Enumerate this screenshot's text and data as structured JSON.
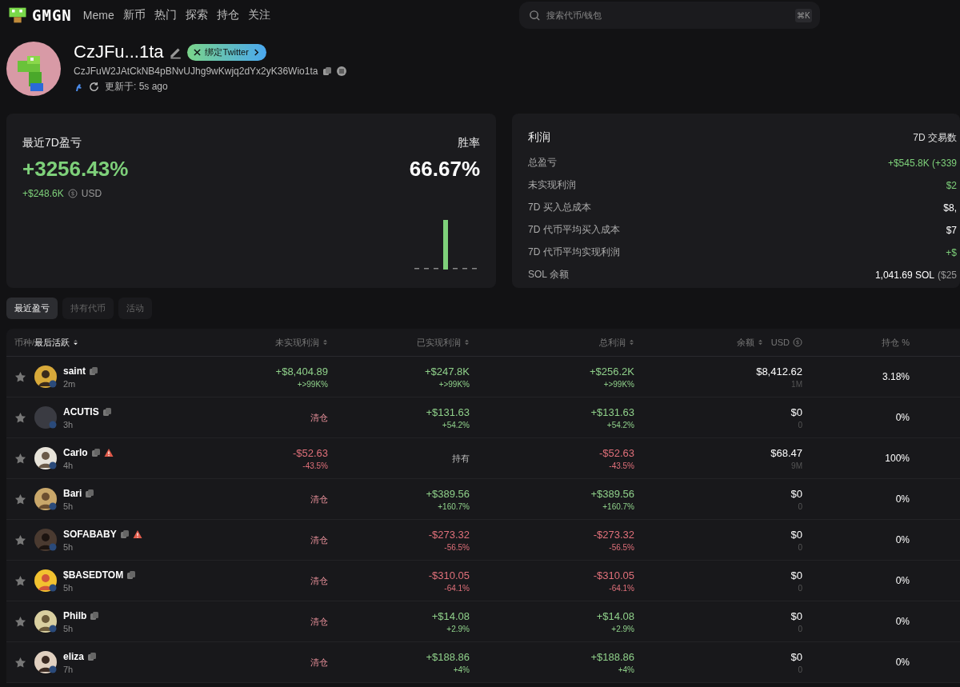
{
  "nav": {
    "brand": "GMGN",
    "items": [
      "Meme",
      "新币",
      "热门",
      "探索",
      "持仓",
      "关注"
    ],
    "search": {
      "placeholder": "搜索代币/钱包",
      "shortcut": "⌘K"
    }
  },
  "profile": {
    "name": "CzJFu...1ta",
    "twitter_button": "绑定Twitter",
    "address": "CzJFuW2JAtCkNB4pBNvUJhg9wKwjq2dYx2yK36Wio1ta",
    "updated": "更新于: 5s ago"
  },
  "pnl_card": {
    "title": "最近7D盈亏",
    "percent": "+3256.43%",
    "amount": "+$248.6K",
    "currency": "USD",
    "winrate_label": "胜率",
    "winrate": "66.67%"
  },
  "profit_card": {
    "title": "利润",
    "right_title": "7D 交易数",
    "rows": [
      {
        "label": "总盈亏",
        "value": "+$545.8K (+339",
        "kind": "gain"
      },
      {
        "label": "未实现利润",
        "value": "$2",
        "kind": "gain"
      },
      {
        "label": "7D 买入总成本",
        "value": "$8,",
        "kind": "plain"
      },
      {
        "label": "7D 代币平均买入成本",
        "value": "$7",
        "kind": "plain"
      },
      {
        "label": "7D 代币平均实现利润",
        "value": "+$",
        "kind": "gain"
      },
      {
        "label": "SOL 余额",
        "value": "1,041.69 SOL",
        "extra": "($25",
        "kind": "plain"
      }
    ]
  },
  "tabs": [
    {
      "label": "最近盈亏",
      "selected": true
    },
    {
      "label": "持有代币",
      "selected": false
    },
    {
      "label": "活动",
      "selected": false
    }
  ],
  "table": {
    "columns": {
      "token": "币种/",
      "token_sorted": "最后活跃",
      "unrealized": "未实现利润",
      "realized": "已实现利润",
      "total": "总利润",
      "balance": "余额",
      "balance_unit": "USD",
      "holding": "持仓 %"
    },
    "rows": [
      {
        "name": "saint",
        "time": "2m",
        "warning": false,
        "unrealized": {
          "text": "+$8,404.89",
          "sub": "+>99K%",
          "kind": "gain"
        },
        "realized": {
          "text": "+$247.8K",
          "sub": "+>99K%",
          "kind": "gain"
        },
        "total": {
          "text": "+$256.2K",
          "sub": "+>99K%",
          "kind": "gain"
        },
        "balance": "$8,412.62",
        "amount": "1M",
        "holding": "3.18%"
      },
      {
        "name": "ACUTIS",
        "time": "3h",
        "warning": false,
        "unrealized": {
          "text": "清仓",
          "kind": "sold"
        },
        "realized": {
          "text": "+$131.63",
          "sub": "+54.2%",
          "kind": "gain"
        },
        "total": {
          "text": "+$131.63",
          "sub": "+54.2%",
          "kind": "gain"
        },
        "balance": "$0",
        "amount": "0",
        "holding": "0%"
      },
      {
        "name": "Carlo",
        "time": "4h",
        "warning": true,
        "unrealized": {
          "text": "-$52.63",
          "sub": "-43.5%",
          "kind": "loss"
        },
        "realized": {
          "text": "持有",
          "kind": "held"
        },
        "total": {
          "text": "-$52.63",
          "sub": "-43.5%",
          "kind": "loss"
        },
        "balance": "$68.47",
        "amount": "9M",
        "holding": "100%"
      },
      {
        "name": "Bari",
        "time": "5h",
        "warning": false,
        "unrealized": {
          "text": "清仓",
          "kind": "sold"
        },
        "realized": {
          "text": "+$389.56",
          "sub": "+160.7%",
          "kind": "gain"
        },
        "total": {
          "text": "+$389.56",
          "sub": "+160.7%",
          "kind": "gain"
        },
        "balance": "$0",
        "amount": "0",
        "holding": "0%"
      },
      {
        "name": "SOFABABY",
        "time": "5h",
        "warning": true,
        "unrealized": {
          "text": "清仓",
          "kind": "sold"
        },
        "realized": {
          "text": "-$273.32",
          "sub": "-56.5%",
          "kind": "loss"
        },
        "total": {
          "text": "-$273.32",
          "sub": "-56.5%",
          "kind": "loss"
        },
        "balance": "$0",
        "amount": "0",
        "holding": "0%"
      },
      {
        "name": "$BASEDTOM",
        "time": "5h",
        "warning": false,
        "unrealized": {
          "text": "清仓",
          "kind": "sold"
        },
        "realized": {
          "text": "-$310.05",
          "sub": "-64.1%",
          "kind": "loss"
        },
        "total": {
          "text": "-$310.05",
          "sub": "-64.1%",
          "kind": "loss"
        },
        "balance": "$0",
        "amount": "0",
        "holding": "0%"
      },
      {
        "name": "Philb",
        "time": "5h",
        "warning": false,
        "unrealized": {
          "text": "清仓",
          "kind": "sold"
        },
        "realized": {
          "text": "+$14.08",
          "sub": "+2.9%",
          "kind": "gain"
        },
        "total": {
          "text": "+$14.08",
          "sub": "+2.9%",
          "kind": "gain"
        },
        "balance": "$0",
        "amount": "0",
        "holding": "0%"
      },
      {
        "name": "eliza",
        "time": "7h",
        "warning": false,
        "unrealized": {
          "text": "清仓",
          "kind": "sold"
        },
        "realized": {
          "text": "+$188.86",
          "sub": "+4%",
          "kind": "gain"
        },
        "total": {
          "text": "+$188.86",
          "sub": "+4%",
          "kind": "gain"
        },
        "balance": "$0",
        "amount": "0",
        "holding": "0%"
      }
    ]
  }
}
